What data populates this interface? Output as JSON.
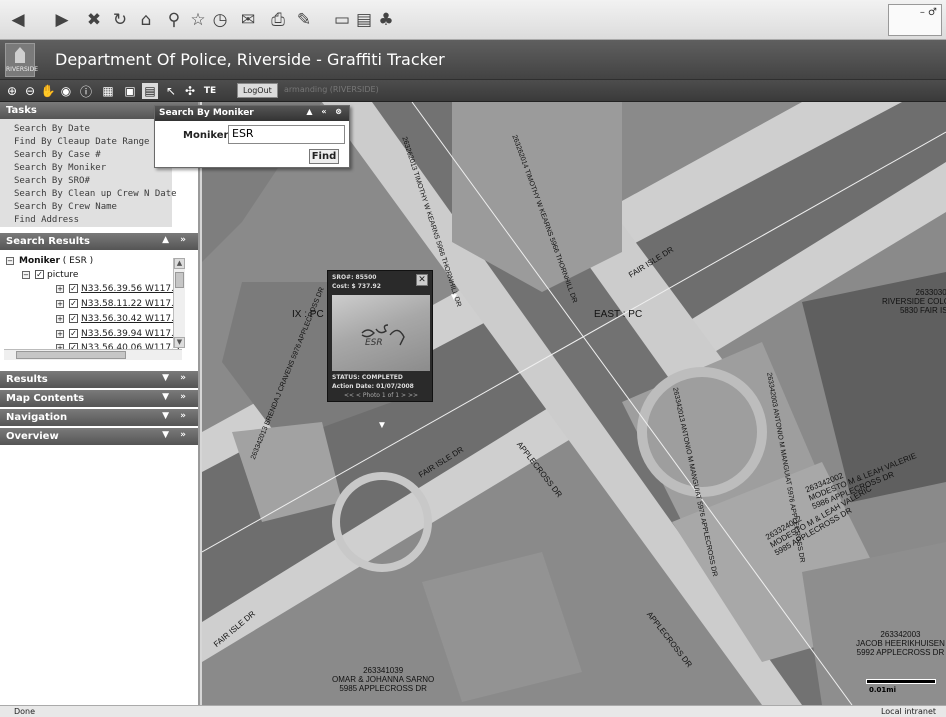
{
  "browser": {
    "toolbar_icons": [
      "back-icon",
      "forward-icon",
      "stop-icon",
      "refresh-icon",
      "home-icon",
      "search-icon",
      "favorites-icon",
      "history-icon",
      "mail-icon",
      "print-icon",
      "edit-icon",
      "discuss-icon",
      "research-icon",
      "messenger-icon"
    ],
    "window_controls": "– ♂"
  },
  "app": {
    "logo_text": "RIVERSIDE",
    "title": "Department Of Police, Riverside - Graffiti Tracker",
    "logout_label": "LogOut",
    "logged_in_user": "armanding (RIVERSIDE)"
  },
  "map_toolbar": {
    "icons": [
      "zoom-in-icon",
      "zoom-out-icon",
      "pan-icon",
      "full-extent-icon",
      "identify-icon",
      "measure-icon",
      "print-map-icon",
      "report-icon",
      "select-icon",
      "snap-icon",
      "text-icon"
    ]
  },
  "tasks": {
    "header": "Tasks",
    "items": [
      "Search By Date",
      "Find By Cleaup Date Range",
      "Search By Case #",
      "Search By Moniker",
      "Search By SRO#",
      "Search By Clean up Crew N Date",
      "Search By Crew Name",
      "Find Address"
    ]
  },
  "search_results": {
    "header": "Search Results",
    "root_label": "Moniker",
    "root_value": "( ESR )",
    "child_label": "picture",
    "rows": [
      "N33.56.39.56  W117.3",
      "N33.58.11.22  W117.2",
      "N33.56.30.42  W117.3",
      "N33.56.39.94  W117.3",
      "N33.56.40.06  W117.3"
    ]
  },
  "panels": {
    "results": "Results",
    "map_contents": "Map Contents",
    "navigation": "Navigation",
    "overview": "Overview"
  },
  "search_popup": {
    "title": "Search By Moniker",
    "label": "Moniker :",
    "value": "ESR",
    "find_label": "Find"
  },
  "info_popup": {
    "sro": "SRO#: 85500",
    "cost": "Cost: $ 737.92",
    "status": "STATUS: COMPLETED",
    "action_date": "Action Date: 01/07/2008",
    "pager": "<< < Photo 1 of 1 > >>",
    "photo_text": "ESR"
  },
  "map": {
    "labels": {
      "east_pc": "EAST : PC",
      "west_pc": "IX : PC",
      "fair_isle_1": "FAIR ISLE DR",
      "fair_isle_2": "FAIR ISLE DR",
      "fair_isle_3": "FAIR ISLE DR",
      "applecross_1": "APPLECROSS DR",
      "applecross_2": "APPLECROSS DR",
      "parcel_a_id": "263303003",
      "parcel_a_name": "RIVERSIDE COLONNADE LL",
      "parcel_a_addr": "5830 FAIR ISLE DR",
      "parcel_b_id": "263342003",
      "parcel_b_name": "JACOB HEERIKHUISEN",
      "parcel_b_addr": "5992 APPLECROSS DR",
      "parcel_c_id": "263341039",
      "parcel_c_name": "OMAR & JOHANNA SARNO",
      "parcel_c_addr": "5985 APPLECROSS DR",
      "parcel_d_id": "263324002",
      "parcel_d_name": "MODESTO M & LEAH VALERIC",
      "parcel_d_addr": "5985 APPLECROSS DR",
      "parcel_e_id": "263342002",
      "parcel_e_name": "MODESTO M & LEAH VALERIE",
      "parcel_e_addr": "5986 APPLECROSS DR",
      "parcel_f_text": "263262014 TIMOTHY W KEARNS 5966 THORNHILL DR",
      "parcel_g_text": "263262013 TIMOTHY W KEARNS 5966 THORNHILL DR",
      "parcel_h_text": "263342013 BRENDA J CRAVENS 5976 APPLECROSS DR",
      "parcel_i_text": "263342003 ANTONIO M MANGUIAT 5976 APPLECROSS DR",
      "parcel_j_text": "263342013 ANTONIO M MANGUIAT 5976 APPLECROSS DR"
    },
    "scale_label": "0.01mi"
  },
  "status_bar": {
    "text": "Done",
    "zone": "Local intranet"
  }
}
